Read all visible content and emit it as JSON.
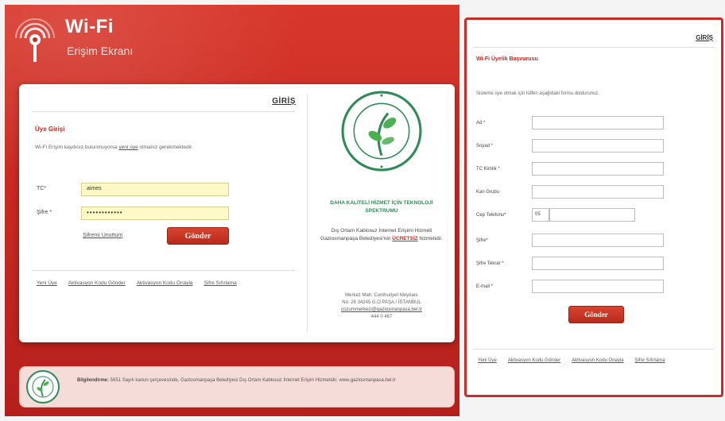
{
  "brand": {
    "title": "Wi-Fi",
    "subtitle": "Erişim Ekranı"
  },
  "login": {
    "heading": "GİRİŞ",
    "section_title": "Üye Girişi",
    "intro_prefix": "Wi-Fi Erişim kaydınız bulunmuyorsa ",
    "intro_link": "yeni üye",
    "intro_suffix": " olmanız gerekmektedir.",
    "tc_label": "TC*",
    "tc_value": "aimes",
    "password_label": "Şifre *",
    "password_value": "••••••••••••",
    "forgot_link": "Şifremi Unuttum",
    "submit_label": "Gönder",
    "footer_links": [
      "Yeni Üye",
      "Aktivasyon Kodu Gönder",
      "Aktivasyon Kodu Onayla",
      "Şifre Sıfırlama"
    ]
  },
  "municipality": {
    "slogan": "DAHA KALİTELİ HİZMET İÇİN TEKNOLOJİ SPEKTRUMU",
    "desc_prefix": "Dış Ortam Kablosuz İnternet Erişimi Hizmeti Gaziosmanpaşa Belediyesi'nin ",
    "desc_bold": "ÜCRETSİZ",
    "desc_suffix": " hizmetidir.",
    "address_line1": "Merkez Mah. Cumhuriyet Meydanı",
    "address_line2": "No: 26 34245 G.O.PAŞA / İSTANBUL",
    "email": "cozummerkezi@gaziosmanpasa.bel.tr",
    "phone": "444 0 467"
  },
  "info_bar": {
    "bold": "Bilgilendirme:",
    "text": " 5651 Sayılı kanun çerçevesinde, Gaziosmanpaşa Belediyesi Dış Ortam Kablosuz İnternet Erişim Hizmetidir. www.gaziosmanpasa.bel.tr"
  },
  "register": {
    "heading": "GİRİŞ",
    "title": "Wi-Fi Üyelik Başvurusu",
    "intro": "Sisteme üye olmak için lütfen aşağıdaki formu doldurunuz.",
    "fields": [
      "Ad *",
      "Soyad *",
      "TC Kimlik *",
      "Kan Grubu",
      "Cep Telefonu*",
      "Şifre*",
      "Şifre Tekrar *",
      "E-mail *"
    ],
    "phone_prefix": "05",
    "submit_label": "Gönder",
    "footer_links": [
      "Yeni Üye",
      "Aktivasyon Kodu Gönder",
      "Aktivasyon Kodu Onayla",
      "Şifre Sıfırlama"
    ]
  },
  "colors": {
    "accent": "#c7281f",
    "field_highlight": "#fff9c8",
    "logo_green": "#2e8b57"
  }
}
